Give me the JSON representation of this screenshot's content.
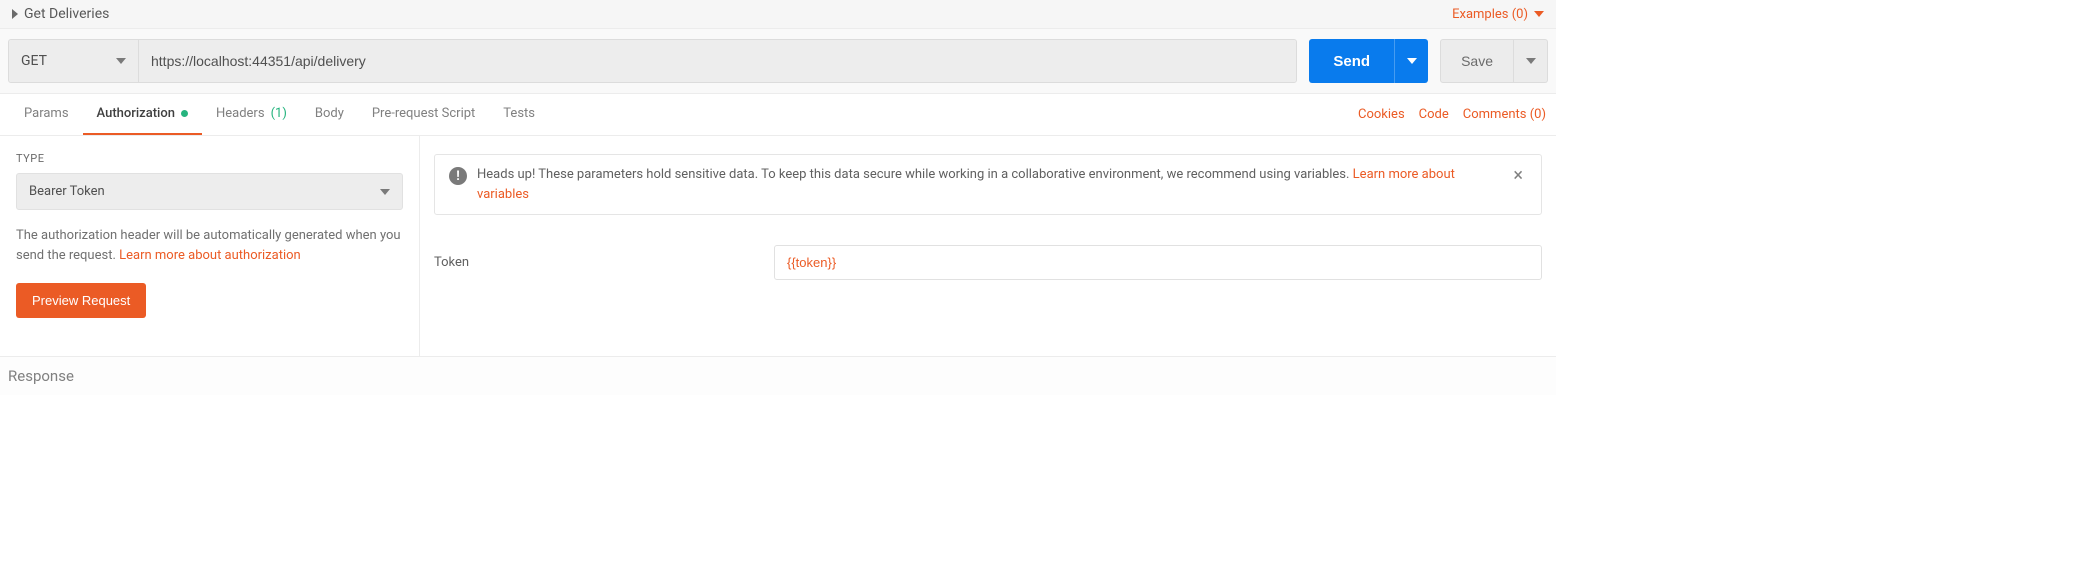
{
  "header": {
    "request_name": "Get Deliveries",
    "examples_label": "Examples (0)"
  },
  "url_bar": {
    "method": "GET",
    "url": "https://localhost:44351/api/delivery",
    "send_label": "Send",
    "save_label": "Save"
  },
  "tabs": {
    "params": "Params",
    "authorization": "Authorization",
    "headers_label": "Headers",
    "headers_count": "(1)",
    "body": "Body",
    "prerequest": "Pre-request Script",
    "tests": "Tests"
  },
  "right_links": {
    "cookies": "Cookies",
    "code": "Code",
    "comments": "Comments (0)"
  },
  "auth_panel": {
    "type_label": "TYPE",
    "type_value": "Bearer Token",
    "desc_prefix": "The authorization header will be automatically generated when you send the request. ",
    "desc_link": "Learn more about authorization",
    "preview_btn": "Preview Request"
  },
  "alert": {
    "text_prefix": "Heads up! These parameters hold sensitive data. To keep this data secure while working in a collaborative environment, we recommend using variables. ",
    "link": "Learn more about variables"
  },
  "token": {
    "label": "Token",
    "value": "{{token}}"
  },
  "response": {
    "label": "Response"
  }
}
